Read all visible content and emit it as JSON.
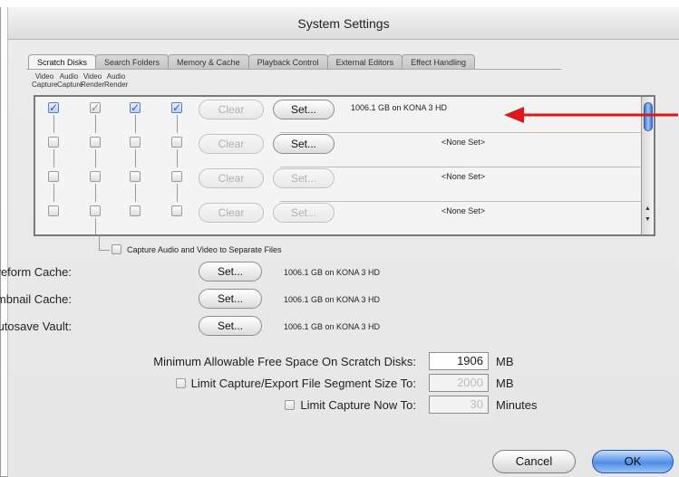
{
  "window": {
    "title": "System Settings"
  },
  "tabs": [
    "Scratch Disks",
    "Search Folders",
    "Memory & Cache",
    "Playback Control",
    "External Editors",
    "Effect Handling"
  ],
  "columns": [
    "Video Capture",
    "Audio Capture",
    "Video Render",
    "Audio Render"
  ],
  "scratch_rows": [
    {
      "checks": [
        true,
        true,
        true,
        true
      ],
      "clear_label": "Clear",
      "set_label": "Set...",
      "info": "1006.1 GB on KONA 3 HD"
    },
    {
      "checks": [
        false,
        false,
        false,
        false
      ],
      "clear_label": "Clear",
      "set_label": "Set...",
      "info": "<None Set>"
    },
    {
      "checks": [
        false,
        false,
        false,
        false
      ],
      "clear_label": "Clear",
      "set_label": "Set...",
      "info": "<None Set>"
    },
    {
      "checks": [
        false,
        false,
        false,
        false
      ],
      "clear_label": "Clear",
      "set_label": "Set...",
      "info": "<None Set>"
    }
  ],
  "separate_files_label": "Capture Audio and Video to Separate Files",
  "caches": [
    {
      "label": "Waveform Cache:",
      "set_label": "Set...",
      "info": "1006.1 GB on KONA 3 HD"
    },
    {
      "label": "Thumbnail Cache:",
      "set_label": "Set...",
      "info": "1006.1 GB on KONA 3 HD"
    },
    {
      "label": "Autosave Vault:",
      "set_label": "Set...",
      "info": "1006.1 GB on KONA 3 HD"
    }
  ],
  "min_free": {
    "label": "Minimum Allowable Free Space On Scratch Disks:",
    "value": "1906",
    "unit": "MB"
  },
  "limit_segment": {
    "label": "Limit Capture/Export File Segment Size To:",
    "value": "2000",
    "unit": "MB"
  },
  "limit_capture": {
    "label": "Limit Capture Now To:",
    "value": "30",
    "unit": "Minutes"
  },
  "buttons": {
    "cancel": "Cancel",
    "ok": "OK"
  },
  "colors": {
    "accent": "#3a74d8",
    "annotation_arrow": "#e0161a"
  }
}
